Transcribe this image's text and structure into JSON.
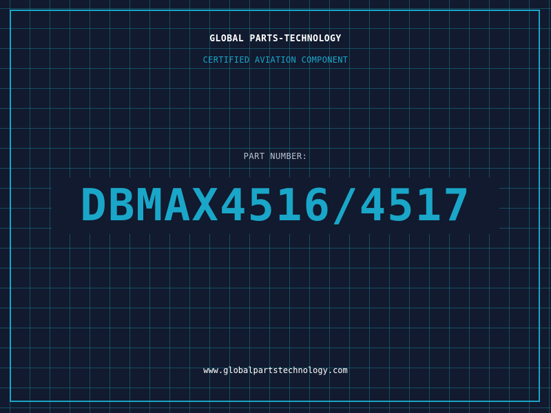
{
  "header": {
    "company": "GLOBAL PARTS-TECHNOLOGY",
    "subtitle": "CERTIFIED AVIATION COMPONENT"
  },
  "part": {
    "label": "PART NUMBER:",
    "number": "DBMAX4516/4517"
  },
  "footer": {
    "website": "www.globalpartstechnology.com"
  },
  "colors": {
    "background": "#111a2e",
    "accent": "#1aa6c9",
    "grid": "#1c788c",
    "text": "#ffffff",
    "muted": "#b9c3cf"
  }
}
